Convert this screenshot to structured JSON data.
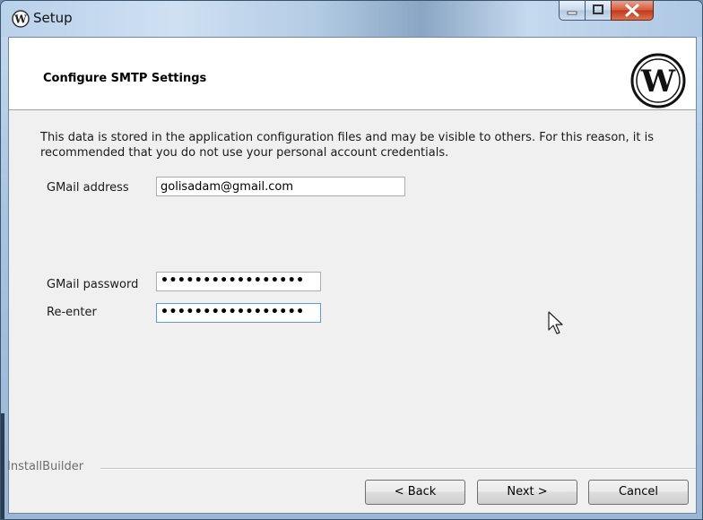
{
  "window": {
    "title": "Setup",
    "controls": [
      "minimize-icon",
      "maximize-icon",
      "close-icon"
    ],
    "colors": {
      "frame": "#a9c4e0",
      "close": "#c1381b"
    }
  },
  "header": {
    "title": "Configure SMTP Settings",
    "logo": "wordpress-logo"
  },
  "main": {
    "description": "This data is stored in the application configuration files and may be visible to others. For this reason, it is recommended that you do not use your personal account credentials.",
    "gmail_address": {
      "label": "GMail address",
      "value": "golisadam@gmail.com"
    },
    "gmail_password": {
      "label": "GMail password",
      "value": "•••••••••••••••••"
    },
    "reenter": {
      "label": "Re-enter",
      "value": "•••••••••••••••••"
    }
  },
  "footer": {
    "brand": "InstallBuilder",
    "back_label": "< Back",
    "next_label": "Next >",
    "cancel_label": "Cancel"
  }
}
